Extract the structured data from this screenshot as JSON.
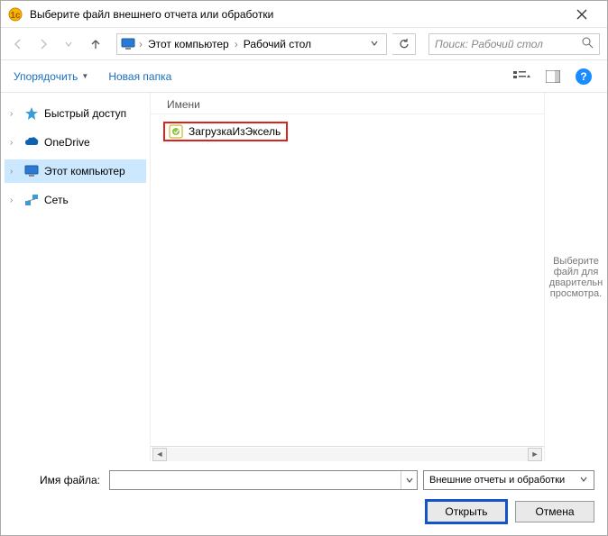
{
  "title": "Выберите файл внешнего отчета или обработки",
  "breadcrumb": {
    "item1": "Этот компьютер",
    "item2": "Рабочий стол"
  },
  "search": {
    "placeholder": "Поиск: Рабочий стол"
  },
  "toolbar": {
    "organize": "Упорядочить",
    "newfolder": "Новая папка"
  },
  "sidebar": {
    "items": [
      {
        "label": "Быстрый доступ"
      },
      {
        "label": "OneDrive"
      },
      {
        "label": "Этот компьютер"
      },
      {
        "label": "Сеть"
      }
    ]
  },
  "filepane": {
    "header": "Имени"
  },
  "files": [
    {
      "name": "ЗагрузкаИзЭксель"
    }
  ],
  "preview": "Выберите файл для дварительн просмотра.",
  "footer": {
    "filename_label": "Имя файла:",
    "filter_label": "Внешние отчеты и обработки",
    "open": "Открыть",
    "cancel": "Отмена"
  }
}
